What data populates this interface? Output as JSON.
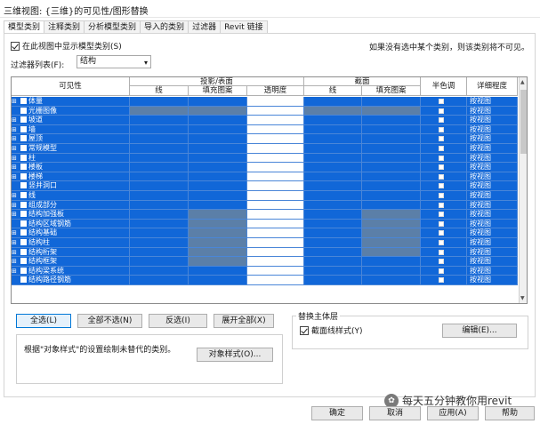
{
  "window": {
    "title": "三维视图: {三维}的可见性/图形替换"
  },
  "tabs": [
    "模型类别",
    "注释类别",
    "分析模型类别",
    "导入的类别",
    "过滤器",
    "Revit 链接"
  ],
  "show_categories": {
    "label": "在此视图中显示模型类别(S)",
    "checked": true
  },
  "hint": "如果没有选中某个类别，则该类别将不可见。",
  "filter": {
    "label": "过滤器列表(F):",
    "value": "结构"
  },
  "grid": {
    "headers": {
      "visibility": "可见性",
      "projection": "投影/表面",
      "cut": "截面",
      "line": "线",
      "fill": "填充图案",
      "transparency": "透明度",
      "cut_line": "线",
      "cut_fill": "填充图案",
      "halftone": "半色调",
      "detail": "详细程度"
    },
    "rows": [
      {
        "name": "体量",
        "expand": "⊞",
        "detail": "按视图"
      },
      {
        "name": "光栅图像",
        "expand": "",
        "detail": "按视图"
      },
      {
        "name": "坡道",
        "expand": "⊞",
        "detail": "按视图"
      },
      {
        "name": "墙",
        "expand": "⊞",
        "detail": "按视图"
      },
      {
        "name": "屋顶",
        "expand": "⊞",
        "detail": "按视图"
      },
      {
        "name": "常规模型",
        "expand": "⊞",
        "detail": "按视图"
      },
      {
        "name": "柱",
        "expand": "⊞",
        "detail": "按视图"
      },
      {
        "name": "楼板",
        "expand": "⊞",
        "detail": "按视图"
      },
      {
        "name": "楼梯",
        "expand": "⊞",
        "detail": "按视图"
      },
      {
        "name": "竖井洞口",
        "expand": "",
        "detail": "按视图"
      },
      {
        "name": "线",
        "expand": "⊞",
        "detail": "按视图"
      },
      {
        "name": "组成部分",
        "expand": "⊞",
        "detail": "按视图"
      },
      {
        "name": "结构加强板",
        "expand": "⊞",
        "detail": "按视图"
      },
      {
        "name": "结构区域钢筋",
        "expand": "",
        "detail": "按视图"
      },
      {
        "name": "结构基础",
        "expand": "⊞",
        "detail": "按视图"
      },
      {
        "name": "结构柱",
        "expand": "⊞",
        "detail": "按视图"
      },
      {
        "name": "结构桁架",
        "expand": "⊞",
        "detail": "按视图"
      },
      {
        "name": "结构框架",
        "expand": "⊞",
        "detail": "按视图"
      },
      {
        "name": "结构梁系统",
        "expand": "⊞",
        "detail": "按视图"
      },
      {
        "name": "结构路径钢筋",
        "expand": "",
        "detail": "按视图"
      }
    ]
  },
  "buttons": {
    "select_all": "全选(L)",
    "select_none": "全部不选(N)",
    "invert": "反选(I)",
    "expand_all": "展开全部(X)",
    "object_styles": "对象样式(O)...",
    "edit": "编辑(E)...",
    "ok": "确定",
    "cancel": "取消",
    "apply": "应用(A)",
    "help": "帮助"
  },
  "note": "根据\"对象样式\"的设置绘制未替代的类别。",
  "host_layer": {
    "title": "替换主体层",
    "cut_line_style": "截面线样式(Y)",
    "checked": true
  },
  "watermark": "每天五分钟教你用revit",
  "colors": {
    "selection": "#1167d8",
    "gray_cell": "#5b7fa8",
    "accent": "#0078d7"
  }
}
